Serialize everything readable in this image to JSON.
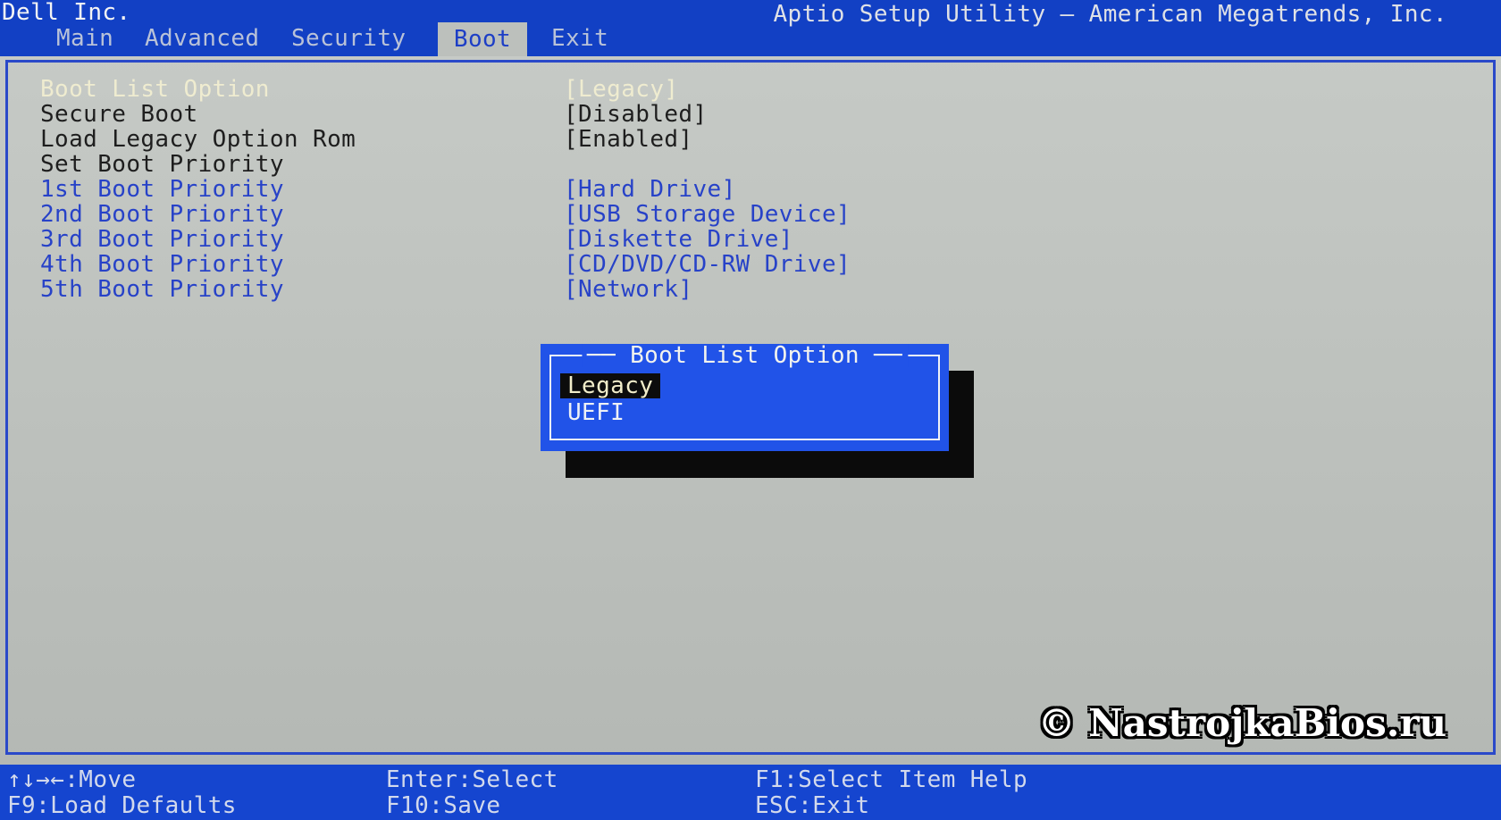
{
  "header": {
    "vendor": "Dell Inc.",
    "title": "Aptio Setup Utility – American Megatrends, Inc.",
    "tabs": [
      {
        "label": "Main",
        "active": false
      },
      {
        "label": "Advanced",
        "active": false
      },
      {
        "label": "Security",
        "active": false
      },
      {
        "label": "Boot",
        "active": true
      },
      {
        "label": "Exit",
        "active": false
      }
    ]
  },
  "settings": [
    {
      "label": "Boot List Option",
      "value": "[Legacy]",
      "state": "selected"
    },
    {
      "label": "Secure Boot",
      "value": "[Disabled]",
      "state": "normal"
    },
    {
      "label": "Load Legacy Option Rom",
      "value": "[Enabled]",
      "state": "normal"
    },
    {
      "label": "Set Boot Priority",
      "value": "",
      "state": "normal"
    },
    {
      "label": "1st Boot Priority",
      "value": "[Hard Drive]",
      "state": "link"
    },
    {
      "label": "2nd Boot Priority",
      "value": "[USB Storage Device]",
      "state": "link"
    },
    {
      "label": "3rd Boot Priority",
      "value": "[Diskette Drive]",
      "state": "link"
    },
    {
      "label": "4th Boot Priority",
      "value": "[CD/DVD/CD-RW Drive]",
      "state": "link"
    },
    {
      "label": "5th Boot Priority",
      "value": "[Network]",
      "state": "link"
    }
  ],
  "popup": {
    "title": "── Boot List Option ──",
    "options": [
      {
        "label": "Legacy",
        "selected": true
      },
      {
        "label": "UEFI",
        "selected": false
      }
    ]
  },
  "footer": {
    "rows": [
      [
        "↑↓→←:Move",
        "Enter:Select",
        "F1:Select Item Help"
      ],
      [
        "F9:Load Defaults",
        "F10:Save",
        "ESC:Exit"
      ]
    ]
  },
  "watermark": {
    "text": "© NastrojkaBios.ru"
  },
  "colors": {
    "header_blue": "#1240c4",
    "footer_blue": "#1545cf",
    "popup_blue": "#2153e8",
    "content_gray": "#bcc0bc",
    "border_blue": "#2a49c9",
    "link_blue": "#2742c8",
    "selected_cream": "#efecd0",
    "highlight_black": "#0c0c0c"
  }
}
